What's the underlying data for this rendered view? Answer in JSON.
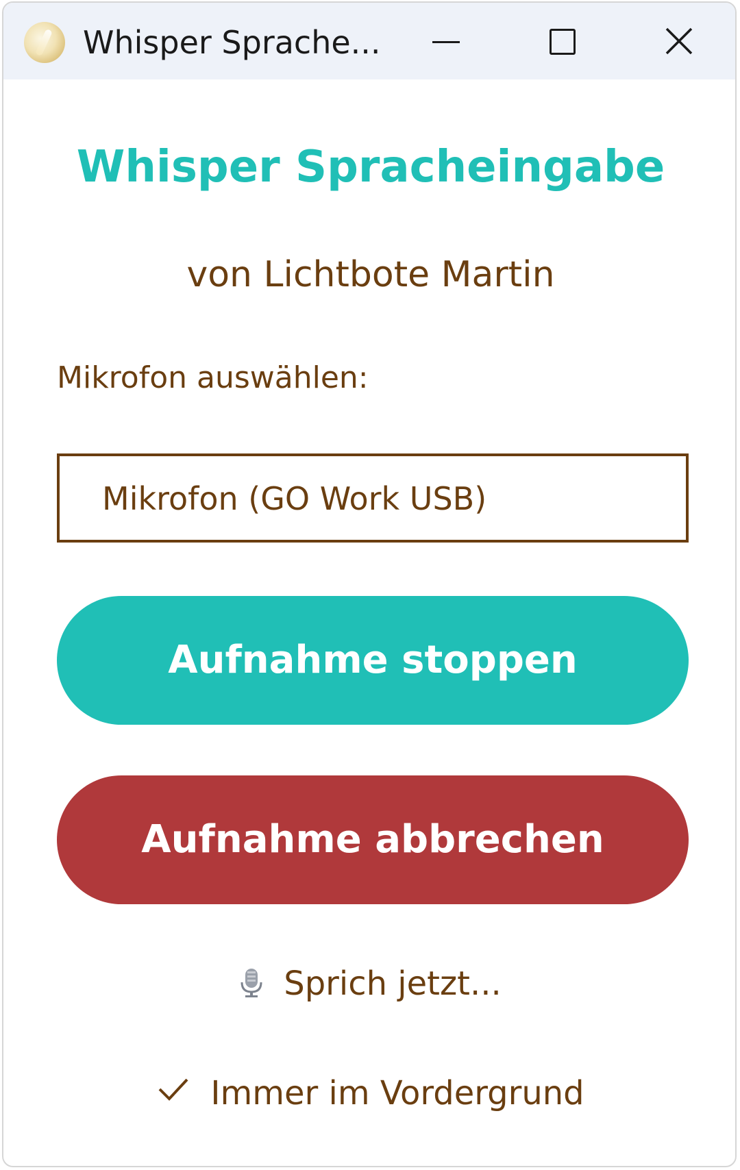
{
  "window": {
    "title": "Whisper Sprache...",
    "controls": [
      "minimize",
      "maximize",
      "close"
    ]
  },
  "main": {
    "heading": "Whisper Spracheingabe",
    "subheading": "von Lichtbote Martin",
    "mic_label": "Mikrofon auswählen:",
    "mic_selected": "Mikrofon (GO Work USB)",
    "stop_button": "Aufnahme stoppen",
    "cancel_button": "Aufnahme abbrechen",
    "status_text": "Sprich jetzt...",
    "always_on_top_label": "Immer im Vordergrund",
    "always_on_top_checked": true
  },
  "colors": {
    "accent": "#20bfb6",
    "danger": "#b0393b",
    "text_brown": "#6a3e10",
    "titlebar_bg": "#eef2f9"
  },
  "icons": {
    "app": "app-logo-icon",
    "minimize": "minimize-icon",
    "maximize": "maximize-icon",
    "close": "close-icon",
    "status": "microphone-icon",
    "check": "checkmark-icon"
  }
}
